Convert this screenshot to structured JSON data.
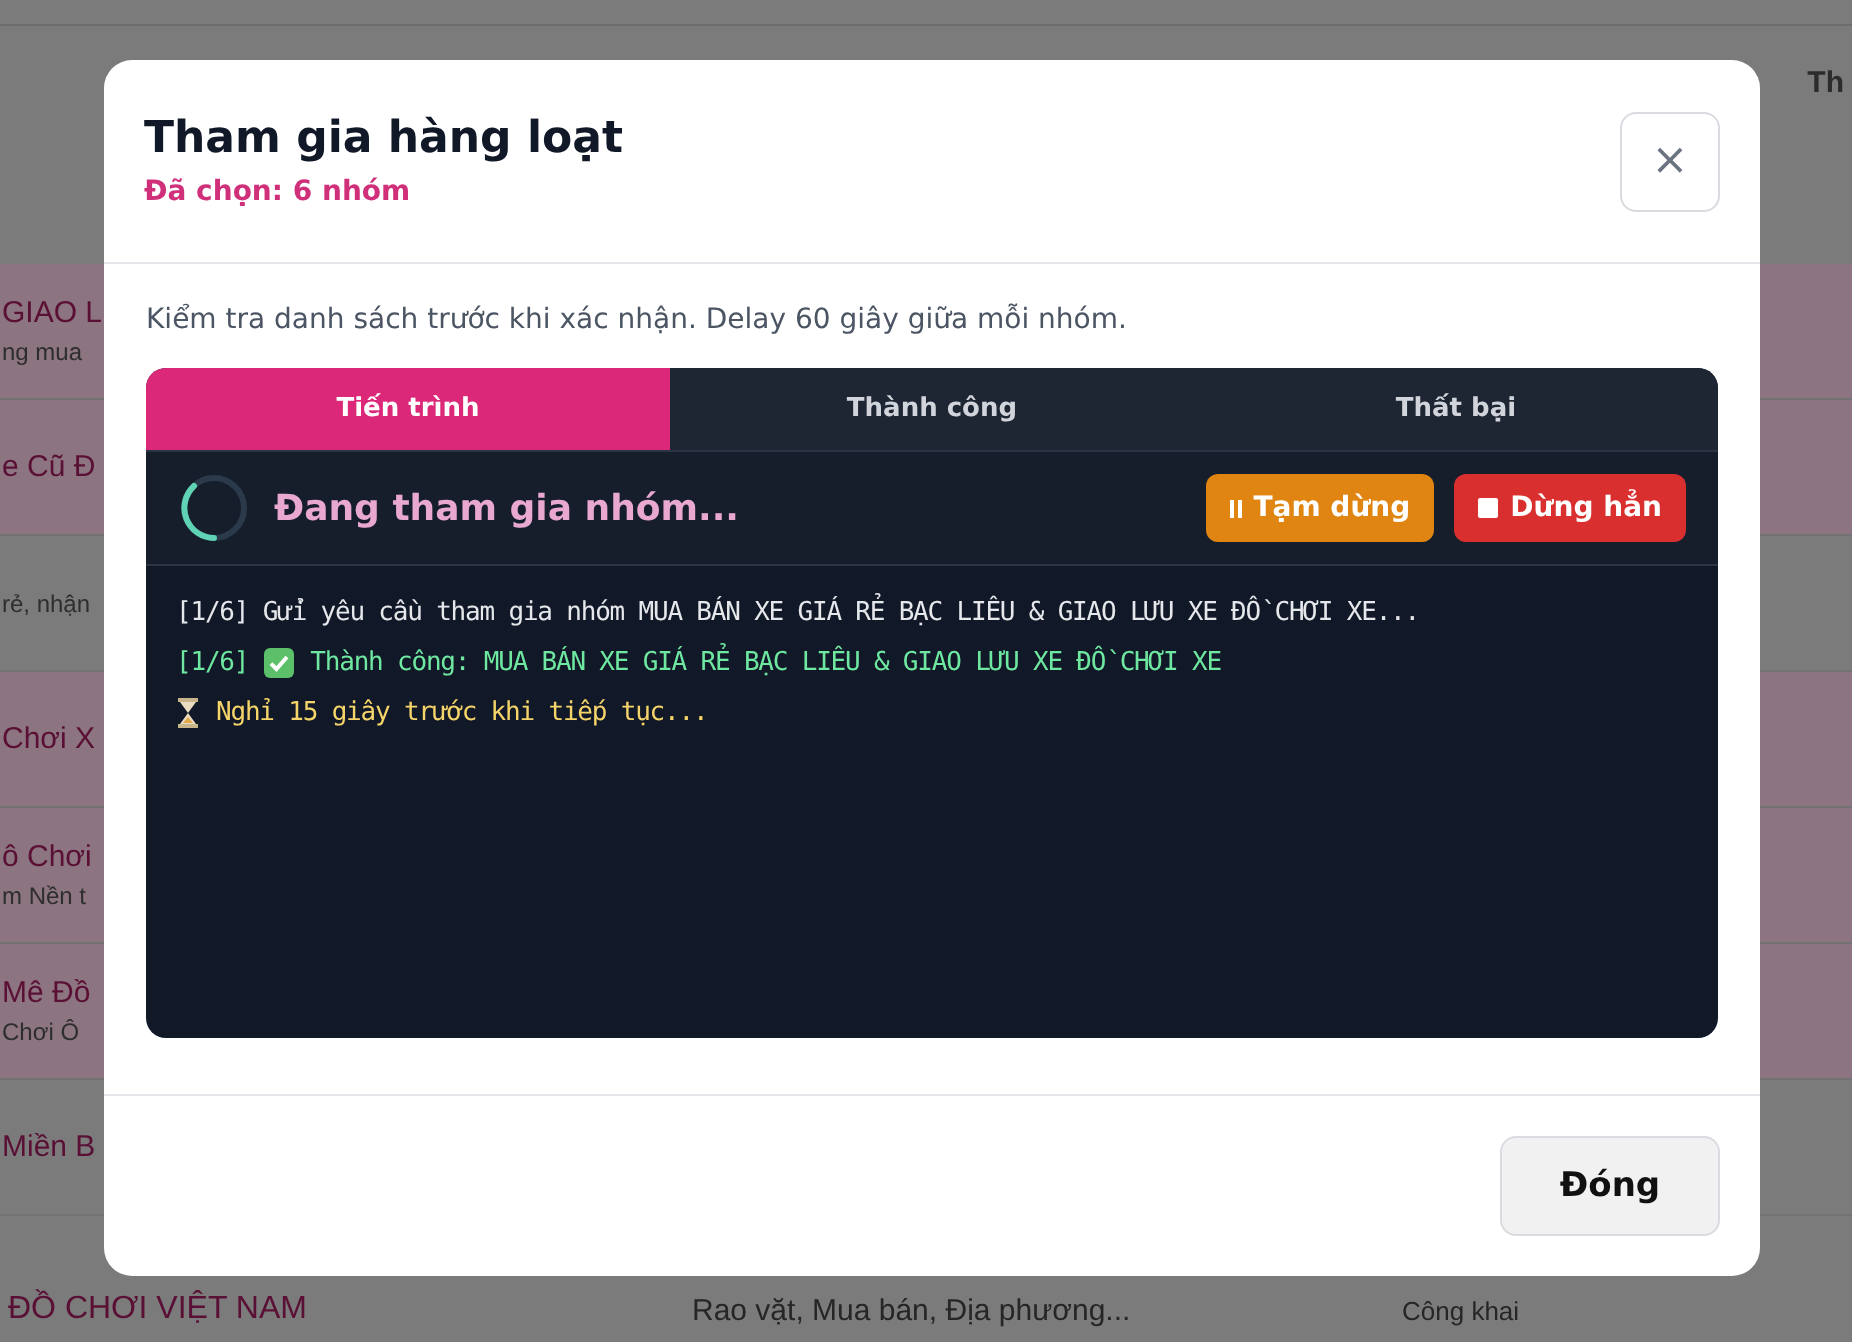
{
  "background_table": {
    "header_cell": "Th",
    "rows": [
      {
        "title": "GIAO L",
        "subtitle": "ng mua",
        "highlighted": true
      },
      {
        "title": "e Cũ Đ",
        "highlighted": true
      },
      {
        "subtitle": "rẻ, nhận",
        "highlighted": false
      },
      {
        "title": "Chơi X",
        "highlighted": true
      },
      {
        "title": "ô Chơi",
        "subtitle": "m Nền t",
        "highlighted": true
      },
      {
        "title": "Mê Đồ",
        "subtitle": "Chơi Ô",
        "highlighted": true
      },
      {
        "title": "Miền B",
        "highlighted": false
      }
    ],
    "last_row": {
      "title": "ĐỒ CHƠI VIỆT NAM",
      "topics": "Rao vặt, Mua bán, Địa phương...",
      "privacy": "Công khai"
    }
  },
  "modal": {
    "title": "Tham gia hàng loạt",
    "subtitle": "Đã chọn: 6 nhóm",
    "close_symbol": "×",
    "note": "Kiểm tra danh sách trước khi xác nhận. Delay 60 giây giữa mỗi nhóm.",
    "tabs": [
      {
        "label": "Tiến trình",
        "selected": true
      },
      {
        "label": "Thành công",
        "selected": false
      },
      {
        "label": "Thất bại",
        "selected": false
      }
    ],
    "status": "Đang tham gia nhóm...",
    "pause_button": "Tạm dừng",
    "stop_button": "Dừng hẳn",
    "log": [
      {
        "kind": "info",
        "text": "[1/6] Gửi yêu cầu tham gia nhóm MUA BÁN XE GIÁ RẺ BẠC LIÊU & GIAO LƯU XE ĐỒ CHƠI XE..."
      },
      {
        "kind": "success",
        "prefix": "[1/6]",
        "text": "Thành công: MUA BÁN XE GIÁ RẺ BẠC LIÊU & GIAO LƯU XE ĐỒ CHƠI XE"
      },
      {
        "kind": "wait",
        "text": "Nghỉ 15 giây trước khi tiếp tục..."
      }
    ],
    "close_button": "Đóng"
  }
}
